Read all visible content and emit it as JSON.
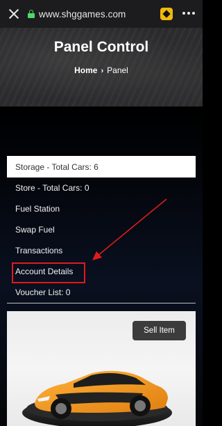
{
  "browser": {
    "url": "www.shggames.com",
    "icons": [
      "close-icon",
      "lock-icon",
      "extension-icon",
      "more-icon"
    ]
  },
  "header": {
    "title": "Panel Control",
    "breadcrumb_home": "Home",
    "breadcrumb_separator": "›",
    "breadcrumb_current": "Panel"
  },
  "menu": {
    "items": [
      {
        "label": "Storage - Total Cars: 6",
        "active": true
      },
      {
        "label": "Store - Total Cars: 0",
        "active": false
      },
      {
        "label": "Fuel Station",
        "active": false
      },
      {
        "label": "Swap Fuel",
        "active": false
      },
      {
        "label": "Transactions",
        "active": false
      },
      {
        "label": "Account Details",
        "active": false,
        "highlighted": true
      },
      {
        "label": "Voucher List: 0",
        "active": false
      }
    ]
  },
  "card": {
    "sell_label": "Sell Item",
    "image": "orange-sports-car"
  },
  "colors": {
    "highlight": "#e01b1b",
    "lock": "#4cd964",
    "car_body": "#f39a1e"
  }
}
